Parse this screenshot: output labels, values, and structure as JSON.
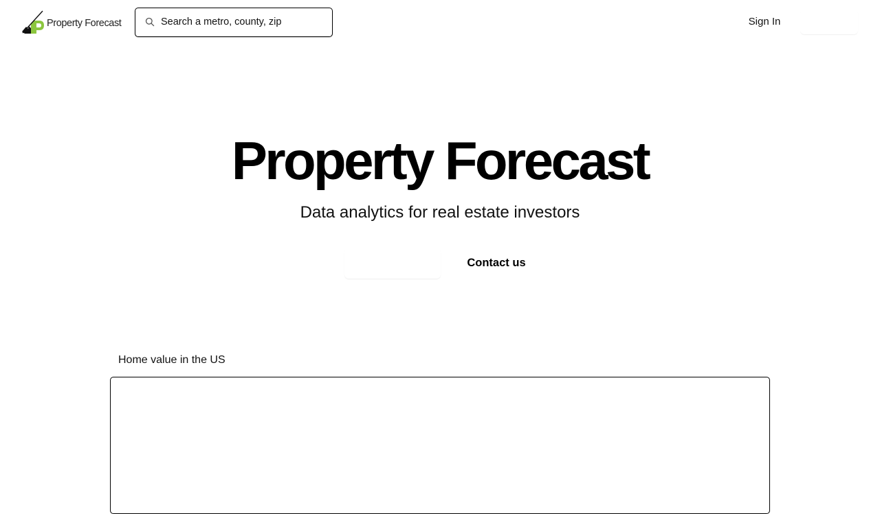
{
  "header": {
    "logo_text": "Property Forecast",
    "search_placeholder": "Search a metro, county, zip",
    "sign_in_label": "Sign In"
  },
  "hero": {
    "title": "Property Forecast",
    "subtitle": "Data analytics for real estate investors",
    "contact_label": "Contact us"
  },
  "chart_section": {
    "label": "Home value in the US"
  },
  "colors": {
    "brand_green": "#8cc63f",
    "text": "#000000",
    "border": "#000000",
    "background": "#ffffff"
  },
  "icons": {
    "logo": "property-forecast-logo-icon",
    "search": "search-icon"
  }
}
